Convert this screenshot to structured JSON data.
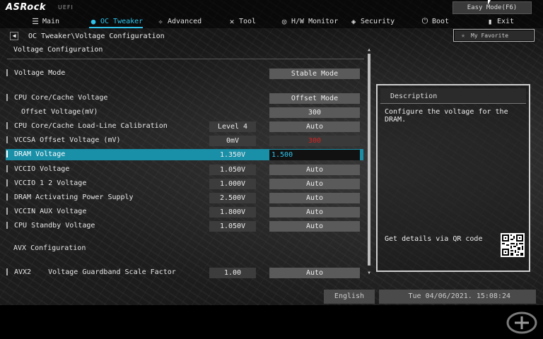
{
  "brand": {
    "logo": "ASRock",
    "sub": "UEFI"
  },
  "easy_mode_label": "Easy Mode(F6)",
  "tabs": [
    {
      "label": "Main",
      "icon": "menu-list-icon",
      "active": false
    },
    {
      "label": "OC Tweaker",
      "icon": "droplet-icon",
      "active": true
    },
    {
      "label": "Advanced",
      "icon": "star-icon",
      "active": false
    },
    {
      "label": "Tool",
      "icon": "wrench-icon",
      "active": false
    },
    {
      "label": "H/W Monitor",
      "icon": "monitor-icon",
      "active": false
    },
    {
      "label": "Security",
      "icon": "shield-icon",
      "active": false
    },
    {
      "label": "Boot",
      "icon": "power-icon",
      "active": false
    },
    {
      "label": "Exit",
      "icon": "exit-door-icon",
      "active": false
    }
  ],
  "my_favorite_label": "My Favorite",
  "breadcrumb": "OC Tweaker\\Voltage Configuration",
  "section_title": "Voltage Configuration",
  "settings": [
    {
      "label": "Voltage Mode",
      "mid": "",
      "right": "Stable Mode"
    },
    {
      "label": "CPU Core/Cache Voltage",
      "mid": "",
      "right": "Offset Mode"
    },
    {
      "label": "Offset Voltage(mV)",
      "mid": "",
      "right": "300"
    },
    {
      "label": "CPU Core/Cache Load-Line Calibration",
      "mid": "Level 4",
      "right": "Auto"
    },
    {
      "label": "VCCSA Offset Voltage (mV)",
      "mid": "0mV",
      "right": "300"
    },
    {
      "label": "DRAM Voltage",
      "mid": "1.350V",
      "right": "1.500"
    },
    {
      "label": "VCCIO Voltage",
      "mid": "1.050V",
      "right": "Auto"
    },
    {
      "label": "VCCIO 1 2 Voltage",
      "mid": "1.000V",
      "right": "Auto"
    },
    {
      "label": "DRAM Activating Power Supply",
      "mid": "2.500V",
      "right": "Auto"
    },
    {
      "label": "VCCIN AUX Voltage",
      "mid": "1.800V",
      "right": "Auto"
    },
    {
      "label": "CPU Standby Voltage",
      "mid": "1.050V",
      "right": "Auto"
    }
  ],
  "avx_heading": "AVX Configuration",
  "avx_row": {
    "label": "AVX2    Voltage Guardband Scale Factor",
    "mid": "1.00",
    "right": "Auto"
  },
  "description": {
    "title": "Description",
    "text": "Configure the voltage for the DRAM.",
    "qr_text": "Get details via QR code"
  },
  "status": {
    "language": "English",
    "datetime": "Tue 04/06/2021. 15:08:24"
  },
  "colors": {
    "accent": "#2ec4ee",
    "highlight_row": "#1a8fa8",
    "warning_value": "#d82020"
  }
}
